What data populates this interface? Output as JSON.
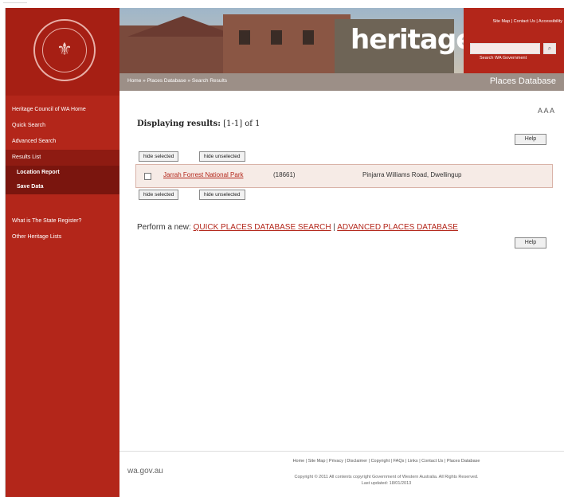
{
  "sidebar": {
    "items": [
      {
        "label": "Heritage Council of WA Home"
      },
      {
        "label": "Quick Search"
      },
      {
        "label": "Advanced Search"
      },
      {
        "label": "Results List"
      }
    ],
    "subitems": [
      {
        "label": "Location Report"
      },
      {
        "label": "Save Data"
      }
    ],
    "lower_items": [
      {
        "label": "What is The State Register?"
      },
      {
        "label": "Other Heritage Lists"
      }
    ]
  },
  "header": {
    "brand": "heritage",
    "top_links": "Site Map | Contact Us | Accessibility",
    "search_label": "Search WA Government",
    "breadcrumb": "Home » Places Database » Search Results",
    "section_title": "Places Database"
  },
  "main": {
    "text_size": "A A A",
    "results_label": "Displaying results:",
    "results_range": "[1-1] of 1",
    "help_label": "Help",
    "hide_selected": "hide selected",
    "hide_unselected": "hide unselected",
    "result": {
      "name": "Jarrah Forrest National Park",
      "id": "(18661)",
      "address": "Pinjarra Williams Road, Dwellingup"
    },
    "perform_label": "Perform a new:",
    "quick_link": "QUICK PLACES DATABASE SEARCH",
    "separator": "|",
    "advanced_link": "ADVANCED PLACES DATABASE"
  },
  "footer": {
    "wagov": "wa.gov.au",
    "links": "Home | Site Map | Privacy | Disclaimer | Copyright | FAQs | Links | Contact Us | Places Database",
    "copyright": "Copyright © 2011 All contents copyright Government of Western Australia. All Rights Reserved.",
    "updated": "Last updated: 18/01/2013"
  },
  "colors": {
    "accent": "#b3261a",
    "bar": "#9c8f87",
    "row_bg": "#f6ebe6"
  }
}
